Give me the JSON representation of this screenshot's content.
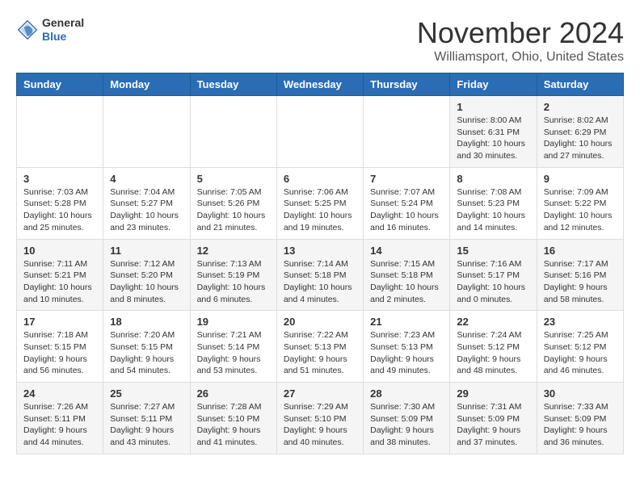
{
  "header": {
    "logo": {
      "general": "General",
      "blue": "Blue"
    },
    "month": "November 2024",
    "location": "Williamsport, Ohio, United States"
  },
  "weekdays": [
    "Sunday",
    "Monday",
    "Tuesday",
    "Wednesday",
    "Thursday",
    "Friday",
    "Saturday"
  ],
  "weeks": [
    [
      {
        "day": "",
        "info": ""
      },
      {
        "day": "",
        "info": ""
      },
      {
        "day": "",
        "info": ""
      },
      {
        "day": "",
        "info": ""
      },
      {
        "day": "",
        "info": ""
      },
      {
        "day": "1",
        "info": "Sunrise: 8:00 AM\nSunset: 6:31 PM\nDaylight: 10 hours\nand 30 minutes."
      },
      {
        "day": "2",
        "info": "Sunrise: 8:02 AM\nSunset: 6:29 PM\nDaylight: 10 hours\nand 27 minutes."
      }
    ],
    [
      {
        "day": "3",
        "info": "Sunrise: 7:03 AM\nSunset: 5:28 PM\nDaylight: 10 hours\nand 25 minutes."
      },
      {
        "day": "4",
        "info": "Sunrise: 7:04 AM\nSunset: 5:27 PM\nDaylight: 10 hours\nand 23 minutes."
      },
      {
        "day": "5",
        "info": "Sunrise: 7:05 AM\nSunset: 5:26 PM\nDaylight: 10 hours\nand 21 minutes."
      },
      {
        "day": "6",
        "info": "Sunrise: 7:06 AM\nSunset: 5:25 PM\nDaylight: 10 hours\nand 19 minutes."
      },
      {
        "day": "7",
        "info": "Sunrise: 7:07 AM\nSunset: 5:24 PM\nDaylight: 10 hours\nand 16 minutes."
      },
      {
        "day": "8",
        "info": "Sunrise: 7:08 AM\nSunset: 5:23 PM\nDaylight: 10 hours\nand 14 minutes."
      },
      {
        "day": "9",
        "info": "Sunrise: 7:09 AM\nSunset: 5:22 PM\nDaylight: 10 hours\nand 12 minutes."
      }
    ],
    [
      {
        "day": "10",
        "info": "Sunrise: 7:11 AM\nSunset: 5:21 PM\nDaylight: 10 hours\nand 10 minutes."
      },
      {
        "day": "11",
        "info": "Sunrise: 7:12 AM\nSunset: 5:20 PM\nDaylight: 10 hours\nand 8 minutes."
      },
      {
        "day": "12",
        "info": "Sunrise: 7:13 AM\nSunset: 5:19 PM\nDaylight: 10 hours\nand 6 minutes."
      },
      {
        "day": "13",
        "info": "Sunrise: 7:14 AM\nSunset: 5:18 PM\nDaylight: 10 hours\nand 4 minutes."
      },
      {
        "day": "14",
        "info": "Sunrise: 7:15 AM\nSunset: 5:18 PM\nDaylight: 10 hours\nand 2 minutes."
      },
      {
        "day": "15",
        "info": "Sunrise: 7:16 AM\nSunset: 5:17 PM\nDaylight: 10 hours\nand 0 minutes."
      },
      {
        "day": "16",
        "info": "Sunrise: 7:17 AM\nSunset: 5:16 PM\nDaylight: 9 hours\nand 58 minutes."
      }
    ],
    [
      {
        "day": "17",
        "info": "Sunrise: 7:18 AM\nSunset: 5:15 PM\nDaylight: 9 hours\nand 56 minutes."
      },
      {
        "day": "18",
        "info": "Sunrise: 7:20 AM\nSunset: 5:15 PM\nDaylight: 9 hours\nand 54 minutes."
      },
      {
        "day": "19",
        "info": "Sunrise: 7:21 AM\nSunset: 5:14 PM\nDaylight: 9 hours\nand 53 minutes."
      },
      {
        "day": "20",
        "info": "Sunrise: 7:22 AM\nSunset: 5:13 PM\nDaylight: 9 hours\nand 51 minutes."
      },
      {
        "day": "21",
        "info": "Sunrise: 7:23 AM\nSunset: 5:13 PM\nDaylight: 9 hours\nand 49 minutes."
      },
      {
        "day": "22",
        "info": "Sunrise: 7:24 AM\nSunset: 5:12 PM\nDaylight: 9 hours\nand 48 minutes."
      },
      {
        "day": "23",
        "info": "Sunrise: 7:25 AM\nSunset: 5:12 PM\nDaylight: 9 hours\nand 46 minutes."
      }
    ],
    [
      {
        "day": "24",
        "info": "Sunrise: 7:26 AM\nSunset: 5:11 PM\nDaylight: 9 hours\nand 44 minutes."
      },
      {
        "day": "25",
        "info": "Sunrise: 7:27 AM\nSunset: 5:11 PM\nDaylight: 9 hours\nand 43 minutes."
      },
      {
        "day": "26",
        "info": "Sunrise: 7:28 AM\nSunset: 5:10 PM\nDaylight: 9 hours\nand 41 minutes."
      },
      {
        "day": "27",
        "info": "Sunrise: 7:29 AM\nSunset: 5:10 PM\nDaylight: 9 hours\nand 40 minutes."
      },
      {
        "day": "28",
        "info": "Sunrise: 7:30 AM\nSunset: 5:09 PM\nDaylight: 9 hours\nand 38 minutes."
      },
      {
        "day": "29",
        "info": "Sunrise: 7:31 AM\nSunset: 5:09 PM\nDaylight: 9 hours\nand 37 minutes."
      },
      {
        "day": "30",
        "info": "Sunrise: 7:33 AM\nSunset: 5:09 PM\nDaylight: 9 hours\nand 36 minutes."
      }
    ]
  ]
}
